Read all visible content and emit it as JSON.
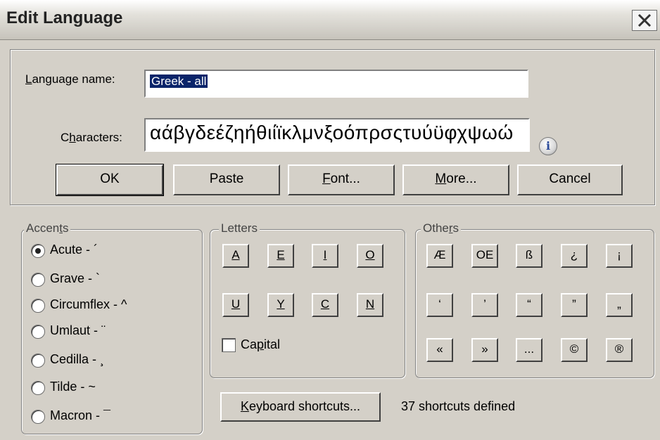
{
  "window": {
    "title": "Edit Language",
    "close_symbol": "✕"
  },
  "language": {
    "name_label_prefix": "",
    "name_label_u": "L",
    "name_label_rest": "anguage name:",
    "name_value": "Greek - all",
    "chars_label_pre": "C",
    "chars_label_u": "h",
    "chars_label_rest": "aracters:",
    "chars_value": "αάβγδεέζηήθιίϊκλμνξοόπρσςτυύϋφχψωώ",
    "info_icon": "i"
  },
  "buttons": {
    "ok": "OK",
    "paste": "Paste",
    "font_u": "F",
    "font_rest": "ont...",
    "more_u": "M",
    "more_rest": "ore...",
    "cancel": "Cancel"
  },
  "accents": {
    "legend_pre": "Accen",
    "legend_u": "t",
    "legend_rest": "s",
    "selected": "Acute - ´",
    "options": [
      "Acute - ´",
      "Grave - `",
      "Circumflex - ^",
      "Umlaut - ¨",
      "Cedilla - ¸",
      "Tilde - ~",
      "Macron - ¯"
    ]
  },
  "letters": {
    "legend": "Letters",
    "row1": [
      "A",
      "E",
      "I",
      "O"
    ],
    "row2": [
      "U",
      "Y",
      "C",
      "N"
    ],
    "capital_pre": "Ca",
    "capital_u": "p",
    "capital_rest": "ital",
    "capital_checked": false
  },
  "others": {
    "legend_pre": "Othe",
    "legend_u": "r",
    "legend_rest": "s",
    "row1": [
      "Æ",
      "OE",
      "ß",
      "¿",
      "¡"
    ],
    "row2": [
      "‘",
      "’",
      "“",
      "”",
      "„"
    ],
    "row3": [
      "«",
      "»",
      "...",
      "©",
      "®"
    ]
  },
  "shortcuts": {
    "button_u": "K",
    "button_rest": "eyboard shortcuts...",
    "status": "37 shortcuts defined"
  }
}
